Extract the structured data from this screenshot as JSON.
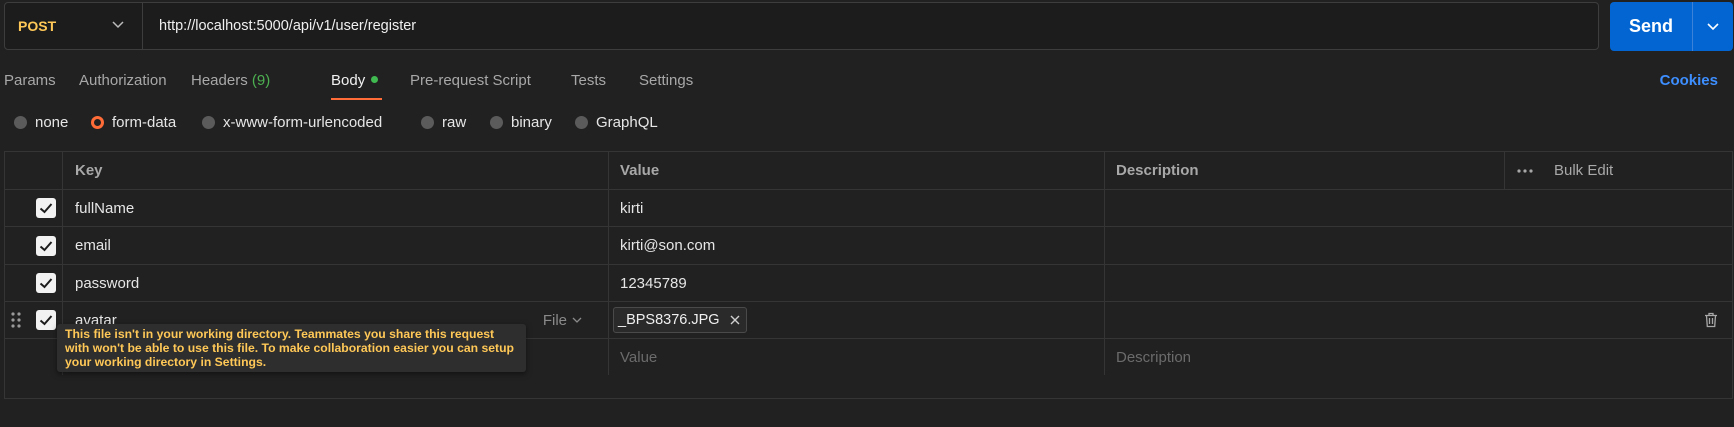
{
  "request": {
    "method": "POST",
    "url": "http://localhost:5000/api/v1/user/register",
    "send_label": "Send"
  },
  "tabs": [
    {
      "label": "Params"
    },
    {
      "label": "Authorization"
    },
    {
      "label": "Headers",
      "count": "(9)"
    },
    {
      "label": "Body",
      "active": true
    },
    {
      "label": "Pre-request Script"
    },
    {
      "label": "Tests"
    },
    {
      "label": "Settings"
    }
  ],
  "cookies_label": "Cookies",
  "body_types": [
    "none",
    "form-data",
    "x-www-form-urlencoded",
    "raw",
    "binary",
    "GraphQL"
  ],
  "selected_body_type": "form-data",
  "table": {
    "headers": {
      "key": "Key",
      "value": "Value",
      "description": "Description",
      "bulk_edit": "Bulk Edit"
    },
    "rows": [
      {
        "key": "fullName",
        "value": "kirti",
        "checked": true
      },
      {
        "key": "email",
        "value": "kirti@son.com",
        "checked": true
      },
      {
        "key": "password",
        "value": "12345789",
        "checked": true
      },
      {
        "key": "avatar",
        "type_label": "File",
        "file": "_BPS8376.JPG",
        "checked": true
      }
    ],
    "new_row": {
      "value_placeholder": "Value",
      "description_placeholder": "Description"
    }
  },
  "tooltip": "This file isn't in your working directory. Teammates you share this request with won't be able to use this file. To make collaboration easier you can setup your working directory in Settings.",
  "colors": {
    "accent": "#ff6c37",
    "send": "#0265d2",
    "method": "#ffc857",
    "cookies": "#3d8eff",
    "status_dot": "#3fb950"
  }
}
